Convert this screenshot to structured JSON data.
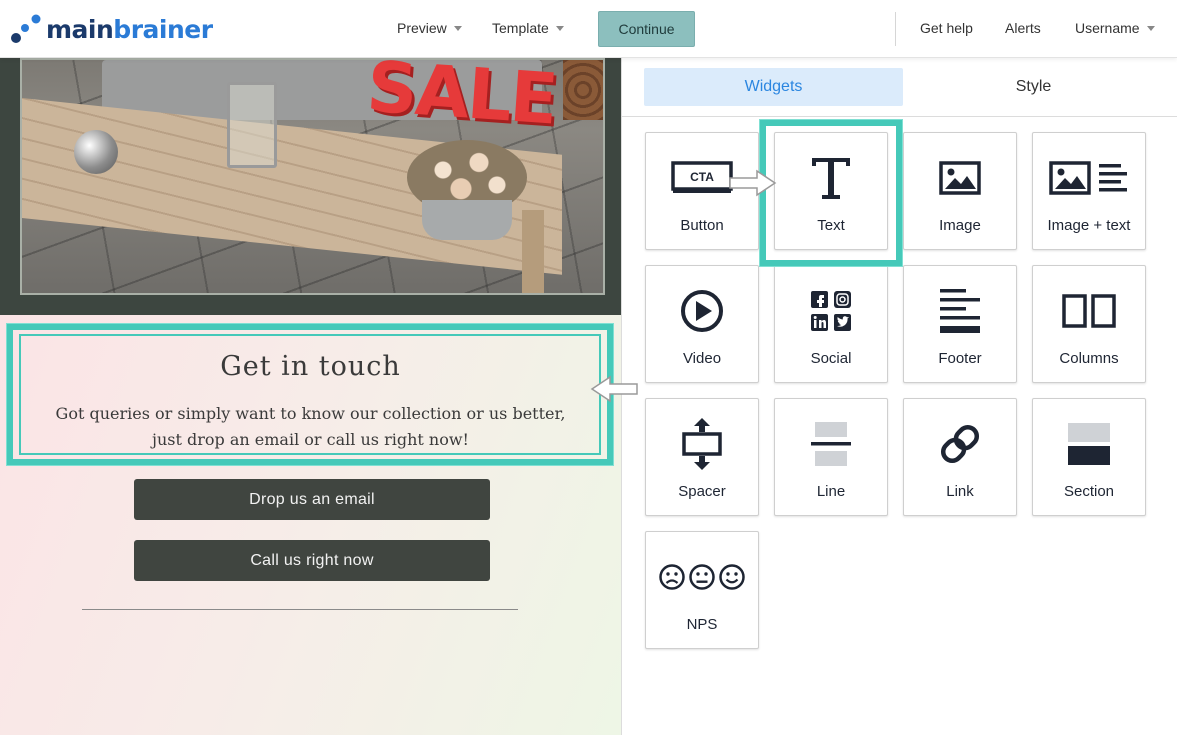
{
  "topbar": {
    "logo_part1": "main",
    "logo_part2": "brainer",
    "preview_label": "Preview",
    "template_label": "Template",
    "continue_label": "Continue",
    "help_label": "Get help",
    "alerts_label": "Alerts",
    "username_label": "Username"
  },
  "canvas": {
    "photo_sign_text": "SALE",
    "heading": "Get in touch",
    "body": "Got queries or simply want to know our collection or us better, just drop an email or call us right now!",
    "email_button": "Drop us an email",
    "call_button": "Call us right now"
  },
  "panel": {
    "tabs": [
      {
        "label": "Widgets",
        "active": true
      },
      {
        "label": "Style",
        "active": false
      }
    ],
    "widgets": [
      {
        "label": "Button",
        "icon": "cta-button-icon",
        "icon_text": "CTA"
      },
      {
        "label": "Text",
        "icon": "text-t-icon"
      },
      {
        "label": "Image",
        "icon": "image-icon"
      },
      {
        "label": "Image + text",
        "icon": "image-text-icon"
      },
      {
        "label": "Video",
        "icon": "play-icon"
      },
      {
        "label": "Social",
        "icon": "social-icons"
      },
      {
        "label": "Footer",
        "icon": "footer-icon"
      },
      {
        "label": "Columns",
        "icon": "columns-icon"
      },
      {
        "label": "Spacer",
        "icon": "spacer-icon"
      },
      {
        "label": "Line",
        "icon": "line-icon"
      },
      {
        "label": "Link",
        "icon": "link-icon"
      },
      {
        "label": "Section",
        "icon": "section-icon"
      },
      {
        "label": "NPS",
        "icon": "nps-faces-icon"
      }
    ]
  },
  "colors": {
    "accent_blue": "#2b86e0",
    "highlight_teal": "#45c9b9",
    "continue_bg": "#8cbfbe",
    "cta_dark": "#404540",
    "icon_navy": "#1e2533"
  }
}
